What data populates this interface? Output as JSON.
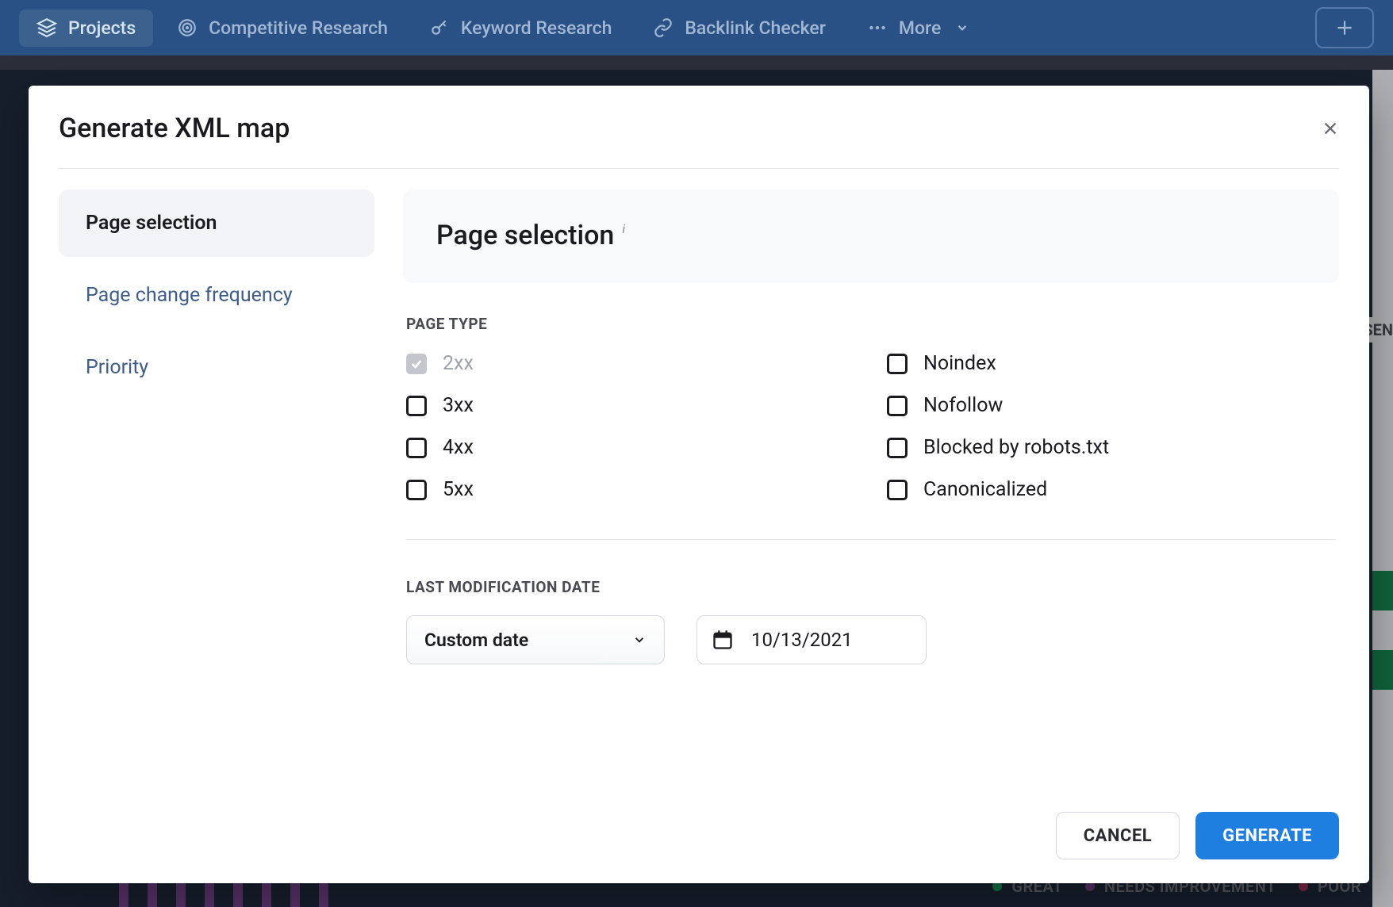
{
  "nav": {
    "items": [
      {
        "label": "Projects",
        "icon": "layers"
      },
      {
        "label": "Competitive Research",
        "icon": "target"
      },
      {
        "label": "Keyword Research",
        "icon": "key"
      },
      {
        "label": "Backlink Checker",
        "icon": "link"
      },
      {
        "label": "More",
        "icon": "dots"
      }
    ]
  },
  "modal": {
    "title": "Generate XML map",
    "tabs": [
      "Page selection",
      "Page change frequency",
      "Priority"
    ],
    "panel_title": "Page selection",
    "page_type_label": "PAGE TYPE",
    "checks_left": [
      "2xx",
      "3xx",
      "4xx",
      "5xx"
    ],
    "checks_right": [
      "Noindex",
      "Nofollow",
      "Blocked by robots.txt",
      "Canonicalized"
    ],
    "lastmod_label": "LAST MODIFICATION DATE",
    "date_mode": "Custom date",
    "date_value": "10/13/2021",
    "cancel": "CANCEL",
    "generate": "GENERATE"
  },
  "legend": {
    "great": "GREAT",
    "needs": "NEEDS IMPROVEMENT",
    "poor": "POOR"
  },
  "sen": "SEN"
}
